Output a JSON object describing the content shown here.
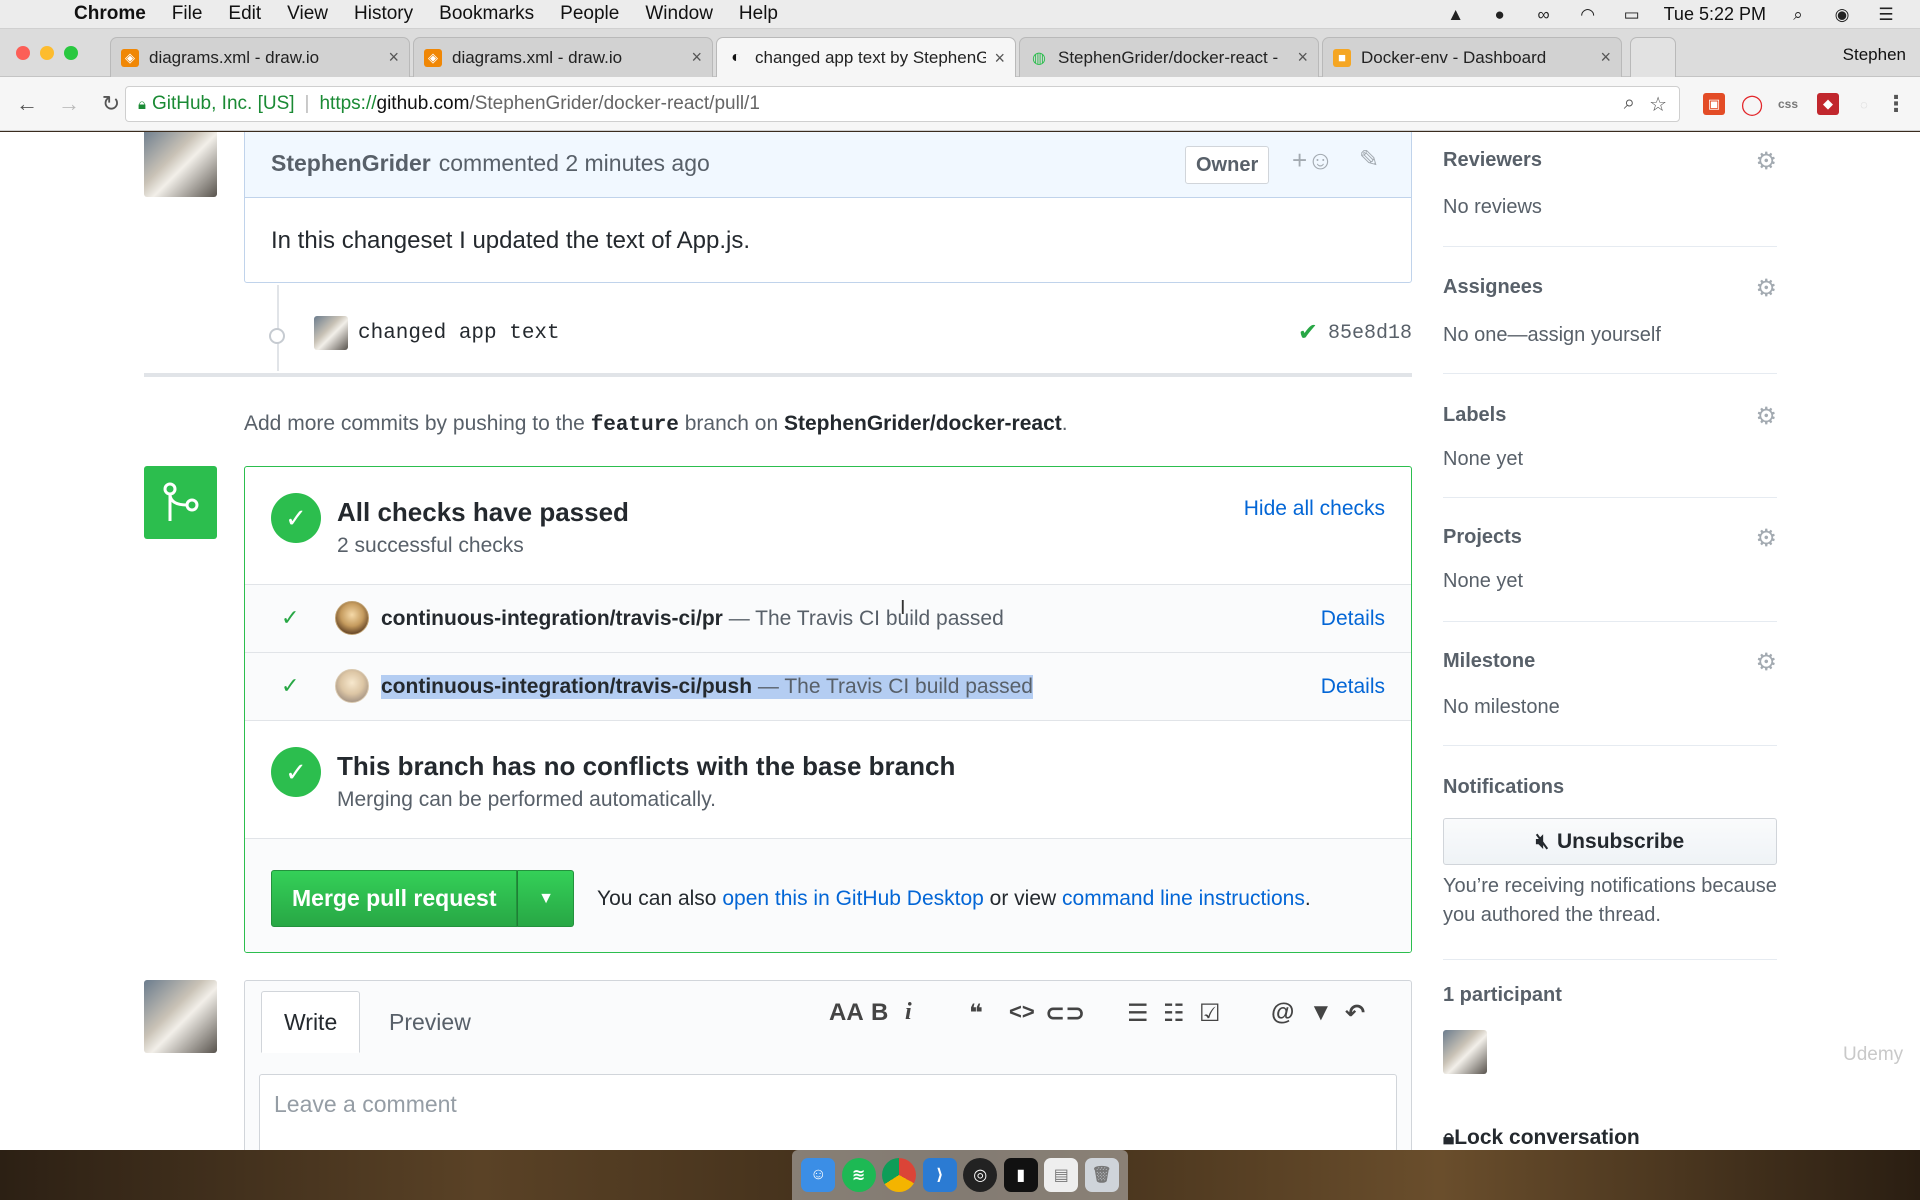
{
  "menubar": {
    "app": "Chrome",
    "items": [
      "File",
      "Edit",
      "View",
      "History",
      "Bookmarks",
      "People",
      "Window",
      "Help"
    ],
    "clock": "Tue 5:22 PM"
  },
  "tabs": [
    {
      "title": "diagrams.xml - draw.io"
    },
    {
      "title": "diagrams.xml - draw.io"
    },
    {
      "title": "changed app text by StephenG"
    },
    {
      "title": "StephenGrider/docker-react -"
    },
    {
      "title": "Docker-env - Dashboard"
    }
  ],
  "profile": "Stephen",
  "address": {
    "org": "GitHub, Inc. [US]",
    "proto": "https://",
    "host": "github.com",
    "path": "/StephenGrider/docker-react/pull/1"
  },
  "comment": {
    "author": "StephenGrider",
    "meta": "commented 2 minutes ago",
    "badge": "Owner",
    "body": "In this changeset I updated the text of App.js."
  },
  "commit": {
    "message": "changed app text",
    "sha": "85e8d18"
  },
  "push_note": {
    "prefix": "Add more commits by pushing to the",
    "branch": "feature",
    "middle": "branch on",
    "repo": "StephenGrider/docker-react",
    "suffix": "."
  },
  "checks": {
    "title": "All checks have passed",
    "subtitle": "2 successful checks",
    "hide_label": "Hide all checks",
    "items": [
      {
        "name": "continuous-integration/travis-ci/pr",
        "desc": "— The Travis CI build passed",
        "details": "Details"
      },
      {
        "name": "continuous-integration/travis-ci/push",
        "desc": "— The Travis CI build passed",
        "details": "Details"
      }
    ]
  },
  "conflicts": {
    "title": "This branch has no conflicts with the base branch",
    "subtitle": "Merging can be performed automatically."
  },
  "merge": {
    "button": "Merge pull request",
    "also_prefix": "You can also",
    "desktop_link": "open this in GitHub Desktop",
    "or_view": "or view",
    "cli_link": "command line instructions",
    "suffix": "."
  },
  "editor": {
    "tab_write": "Write",
    "tab_preview": "Preview",
    "placeholder": "Leave a comment",
    "tool_heading": "AA",
    "tool_bold": "B",
    "tool_italic": "i"
  },
  "sidebar": {
    "reviewers": {
      "title": "Reviewers",
      "value": "No reviews"
    },
    "assignees": {
      "title": "Assignees",
      "value": "No one—assign yourself"
    },
    "labels": {
      "title": "Labels",
      "value": "None yet"
    },
    "projects": {
      "title": "Projects",
      "value": "None yet"
    },
    "milestone": {
      "title": "Milestone",
      "value": "No milestone"
    },
    "notifications": {
      "title": "Notifications",
      "button": "Unsubscribe",
      "text": "You’re receiving notifications because you authored the thread."
    },
    "participants": "1 participant",
    "lock": "Lock conversation"
  },
  "watermark": "Udemy",
  "colors": {
    "green": "#2cbe4e",
    "link": "#0366d6",
    "selection": "#b4cdf2"
  }
}
